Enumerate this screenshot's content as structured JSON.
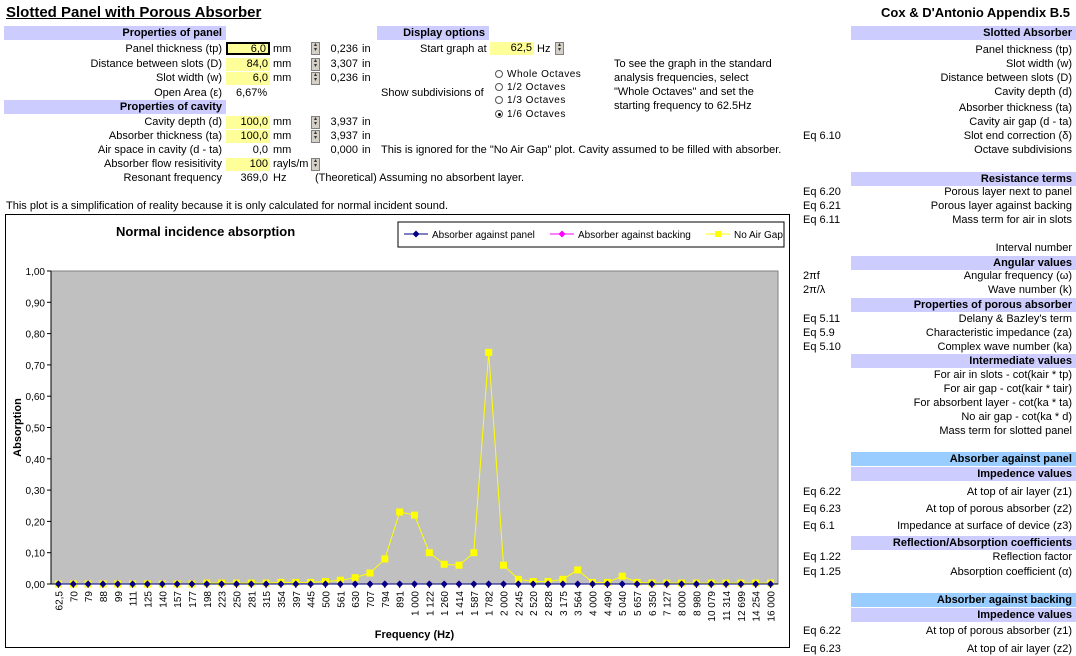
{
  "title": "Slotted Panel with Porous Absorber",
  "right_title": "Cox & D'Antonio Appendix B.5",
  "panel": {
    "header": "Properties of panel",
    "rows": [
      {
        "label": "Panel thickness (tp)",
        "value": "6,0",
        "unit": "mm",
        "conv": "0,236",
        "conv_unit": "in"
      },
      {
        "label": "Distance between slots (D)",
        "value": "84,0",
        "unit": "mm",
        "conv": "3,307",
        "conv_unit": "in"
      },
      {
        "label": "Slot width (w)",
        "value": "6,0",
        "unit": "mm",
        "conv": "0,236",
        "conv_unit": "in"
      }
    ],
    "open_area_label": "Open Area (ε)",
    "open_area_value": "6,67%"
  },
  "cavity": {
    "header": "Properties of cavity",
    "rows": [
      {
        "label": "Cavity depth (d)",
        "value": "100,0",
        "unit": "mm",
        "conv": "3,937",
        "conv_unit": "in"
      },
      {
        "label": "Absorber thickness (ta)",
        "value": "100,0",
        "unit": "mm",
        "conv": "3,937",
        "conv_unit": "in"
      }
    ],
    "air_space_label": "Air space in cavity (d - ta)",
    "air_space_value": "0,0",
    "air_space_unit": "mm",
    "air_space_conv": "0,000",
    "air_space_conv_unit": "in",
    "air_space_note": "This is ignored for the \"No Air Gap\" plot.  Cavity assumed to be filled with absorber.",
    "flow_label": "Absorber flow resisitivity",
    "flow_value": "100",
    "flow_unit": "rayls/m",
    "resonant_label": "Resonant frequency",
    "resonant_value": "369,0",
    "resonant_unit": "Hz",
    "resonant_note": "(Theoretical) Assuming no absorbent layer."
  },
  "display": {
    "header": "Display options",
    "start_label": "Start graph at",
    "start_value": "62,5",
    "start_unit": "Hz",
    "subdiv_label": "Show subdivisions of",
    "options": [
      "Whole Octaves",
      "1/2 Octaves",
      "1/3 Octaves",
      "1/6 Octaves"
    ],
    "selected": "1/6 Octaves",
    "help": [
      "To see the graph in the standard",
      "analysis frequencies, select",
      "\"Whole Octaves\" and set the",
      "starting frequency to 62.5Hz"
    ]
  },
  "note": "This plot is a simplification of reality because it is only calculated for normal incident sound.",
  "sidebar": {
    "sections": [
      {
        "header": "Slotted Absorber",
        "style": "light",
        "items": [
          {
            "eq": "",
            "label": "Panel thickness (tp)"
          },
          {
            "eq": "",
            "label": "Slot width (w)"
          },
          {
            "eq": "",
            "label": "Distance between slots (D)"
          },
          {
            "eq": "",
            "label": "Cavity depth (d)"
          },
          {
            "eq": "",
            "label": "Absorber thickness (ta)"
          },
          {
            "eq": "",
            "label": "Cavity air gap (d - ta)"
          },
          {
            "eq": "Eq 6.10",
            "label": "Slot end correction (δ)"
          },
          {
            "eq": "",
            "label": "Octave subdivisions"
          }
        ]
      },
      {
        "header": "Resistance terms",
        "style": "light",
        "items": [
          {
            "eq": "Eq 6.20",
            "label": "Porous layer next to panel"
          },
          {
            "eq": "Eq 6.21",
            "label": "Porous layer against backing"
          },
          {
            "eq": "Eq 6.11",
            "label": "Mass term for air in slots"
          },
          {
            "eq": "",
            "label": ""
          },
          {
            "eq": "",
            "label": "Interval number"
          }
        ]
      },
      {
        "header": "Angular values",
        "style": "light",
        "items": [
          {
            "eq": "2πf",
            "label": "Angular frequency (ω)"
          },
          {
            "eq": "2π/λ",
            "label": "Wave number (k)"
          }
        ]
      },
      {
        "header": "Properties of porous absorber",
        "style": "light",
        "items": [
          {
            "eq": "Eq 5.11",
            "label": "Delany & Bazley's term"
          },
          {
            "eq": "Eq 5.9",
            "label": "Characteristic impedance (za)"
          },
          {
            "eq": "Eq 5.10",
            "label": "Complex wave number (ka)"
          }
        ]
      },
      {
        "header": "Intermediate values",
        "style": "light",
        "items": [
          {
            "eq": "",
            "label": "For air in slots - cot(kair * tp)"
          },
          {
            "eq": "",
            "label": "For air gap - cot(kair * tair)"
          },
          {
            "eq": "",
            "label": "For absorbent layer - cot(ka * ta)"
          },
          {
            "eq": "",
            "label": "No air gap - cot(ka * d)"
          },
          {
            "eq": "",
            "label": "Mass term for slotted panel"
          }
        ]
      },
      {
        "header": "Absorber against panel",
        "style": "dark",
        "items": []
      },
      {
        "header": "Impedence values",
        "style": "light",
        "items": [
          {
            "eq": "Eq 6.22",
            "label": "At top of air layer (z1)"
          },
          {
            "eq": "Eq 6.23",
            "label": "At top of porous absorber (z2)"
          },
          {
            "eq": "Eq 6.1",
            "label": "Impedance at surface of device (z3)"
          }
        ]
      },
      {
        "header": "Reflection/Absorption coefficients",
        "style": "light",
        "items": [
          {
            "eq": "Eq 1.22",
            "label": "Reflection factor"
          },
          {
            "eq": "Eq 1.25",
            "label": "Absorption coefficient (α)"
          }
        ]
      },
      {
        "header": "Absorber against backing",
        "style": "dark",
        "items": []
      },
      {
        "header": "Impedence values",
        "style": "light",
        "items": [
          {
            "eq": "Eq 6.22",
            "label": "At top of porous absorber (z1)"
          },
          {
            "eq": "Eq 6.23",
            "label": "At top of air layer (z2)"
          }
        ]
      }
    ]
  },
  "colors": {
    "header_light": "#ccccff",
    "header_dark": "#99ccff",
    "input_bg": "#ffff99",
    "plot_bg": "#c0c0c0"
  },
  "chart_data": {
    "type": "line",
    "title": "Normal incidence absorption",
    "xlabel": "Frequency (Hz)",
    "ylabel": "Absorption",
    "ylim": [
      0,
      1
    ],
    "yticks": [
      "0,00",
      "0,10",
      "0,20",
      "0,30",
      "0,40",
      "0,50",
      "0,60",
      "0,70",
      "0,80",
      "0,90",
      "1,00"
    ],
    "categories": [
      "62,5",
      "70",
      "79",
      "88",
      "99",
      "111",
      "125",
      "140",
      "157",
      "177",
      "198",
      "223",
      "250",
      "281",
      "315",
      "354",
      "397",
      "445",
      "500",
      "561",
      "630",
      "707",
      "794",
      "891",
      "1 000",
      "1 122",
      "1 260",
      "1 414",
      "1 587",
      "1 782",
      "2 000",
      "2 245",
      "2 520",
      "2 828",
      "3 175",
      "3 564",
      "4 000",
      "4 490",
      "5 040",
      "5 657",
      "6 350",
      "7 127",
      "8 000",
      "8 980",
      "10 079",
      "11 314",
      "12 699",
      "14 254",
      "16 000"
    ],
    "series": [
      {
        "name": "Absorber against panel",
        "color": "#000080",
        "marker": "diamond",
        "values": [
          0,
          0,
          0,
          0,
          0,
          0,
          0,
          0,
          0,
          0,
          0,
          0,
          0,
          0,
          0,
          0,
          0,
          0,
          0,
          0,
          0,
          0,
          0,
          0,
          0,
          0,
          0,
          0,
          0,
          0,
          0,
          0,
          0,
          0,
          0,
          0,
          0,
          0,
          0,
          0,
          0,
          0,
          0,
          0,
          0,
          0,
          0,
          0,
          0
        ]
      },
      {
        "name": "Absorber against backing",
        "color": "#ff00ff",
        "marker": "diamond",
        "values": [
          0,
          0,
          0,
          0,
          0,
          0,
          0,
          0,
          0,
          0,
          0,
          0,
          0,
          0,
          0,
          0,
          0,
          0,
          0,
          0,
          0,
          0,
          0,
          0,
          0,
          0,
          0,
          0,
          0,
          0,
          0,
          0,
          0,
          0,
          0,
          0,
          0,
          0,
          0,
          0,
          0,
          0,
          0,
          0,
          0,
          0,
          0,
          0,
          0
        ]
      },
      {
        "name": "No Air Gap",
        "color": "#ffff00",
        "marker": "square",
        "values": [
          0.0,
          0.0,
          0.0,
          0.0,
          0.0,
          0.0,
          0.0,
          0.0,
          0.0,
          0.0,
          0.003,
          0.003,
          0.003,
          0.003,
          0.003,
          0.005,
          0.005,
          0.005,
          0.008,
          0.012,
          0.02,
          0.035,
          0.08,
          0.23,
          0.22,
          0.1,
          0.063,
          0.06,
          0.1,
          0.74,
          0.06,
          0.015,
          0.008,
          0.008,
          0.015,
          0.045,
          0.005,
          0.005,
          0.025,
          0.005,
          0.003,
          0.003,
          0.003,
          0.003,
          0.003,
          0.003,
          0.003,
          0.003,
          0.003
        ]
      }
    ],
    "legend": "top-right",
    "grid": false
  }
}
